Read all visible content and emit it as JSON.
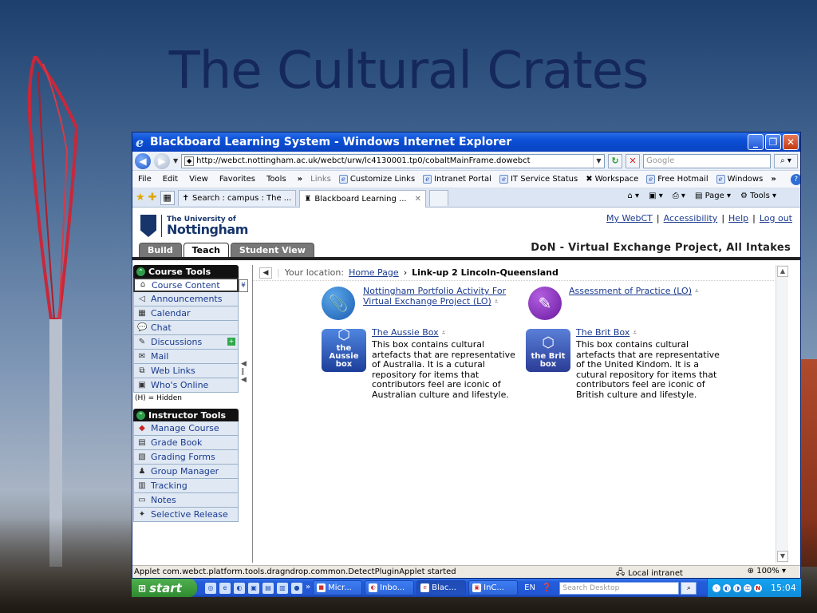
{
  "slide": {
    "title": "The Cultural Crates"
  },
  "browser": {
    "title": "Blackboard Learning System - Windows Internet Explorer",
    "url": "http://webct.nottingham.ac.uk/webct/urw/lc4130001.tp0/cobaltMainFrame.dowebct",
    "search_placeholder": "Google",
    "menu": [
      "File",
      "Edit",
      "View",
      "Favorites",
      "Tools"
    ],
    "links_label": "Links",
    "links": [
      "Customize Links",
      "Intranet Portal",
      "IT Service Status",
      "Workspace",
      "Free Hotmail",
      "Windows"
    ],
    "tabs": [
      {
        "label": "Search : campus : The ..."
      },
      {
        "label": "Blackboard Learning ..."
      }
    ],
    "tab_tools": {
      "page": "Page",
      "tools": "Tools"
    },
    "status": {
      "text": "Applet com.webct.platform.tools.dragndrop.common.DetectPluginApplet started",
      "zone": "Local intranet",
      "zoom": "100%"
    }
  },
  "page": {
    "university": {
      "small": "The University of",
      "big": "Nottingham"
    },
    "toplinks": [
      "My WebCT",
      "Accessibility",
      "Help",
      "Log out"
    ],
    "course_title": "DoN - Virtual Exchange Project, All Intakes",
    "mode_tabs": [
      "Build",
      "Teach",
      "Student View"
    ],
    "course_tools": {
      "title": "Course Tools",
      "items": [
        "Course Content",
        "Announcements",
        "Calendar",
        "Chat",
        "Discussions",
        "Mail",
        "Web Links",
        "Who's Online"
      ]
    },
    "hidden_note": "(H) = Hidden",
    "instructor_tools": {
      "title": "Instructor Tools",
      "items": [
        "Manage Course",
        "Grade Book",
        "Grading Forms",
        "Group Manager",
        "Tracking",
        "Notes",
        "Selective Release"
      ]
    },
    "location": {
      "label": "Your location:",
      "home": "Home Page",
      "current": "Link-up 2 Lincoln-Queensland"
    },
    "items": [
      {
        "title": "Nottingham Portfolio Activity For Virtual Exchange Project (LO)"
      },
      {
        "title": "Assessment of Practice (LO)"
      },
      {
        "title": "The Aussie Box",
        "icon_text": "the Aussie box",
        "desc": "This box contains cultural artefacts that are representative of Australia. It is a cutural repository for items that contributors feel are iconic of Australian culture and lifestyle."
      },
      {
        "title": "The Brit Box",
        "icon_text": "the Brit box",
        "desc": "This box contains cultural artefacts that are representative of the United Kindom. It is a cutural repository for items that contributors feel are iconic of British culture and lifestyle."
      }
    ]
  },
  "taskbar": {
    "start": "start",
    "items": [
      "Micr...",
      "Inbo...",
      "Blac...",
      "InC..."
    ],
    "lang": "EN",
    "search_placeholder": "Search Desktop",
    "clock": "15:04"
  }
}
